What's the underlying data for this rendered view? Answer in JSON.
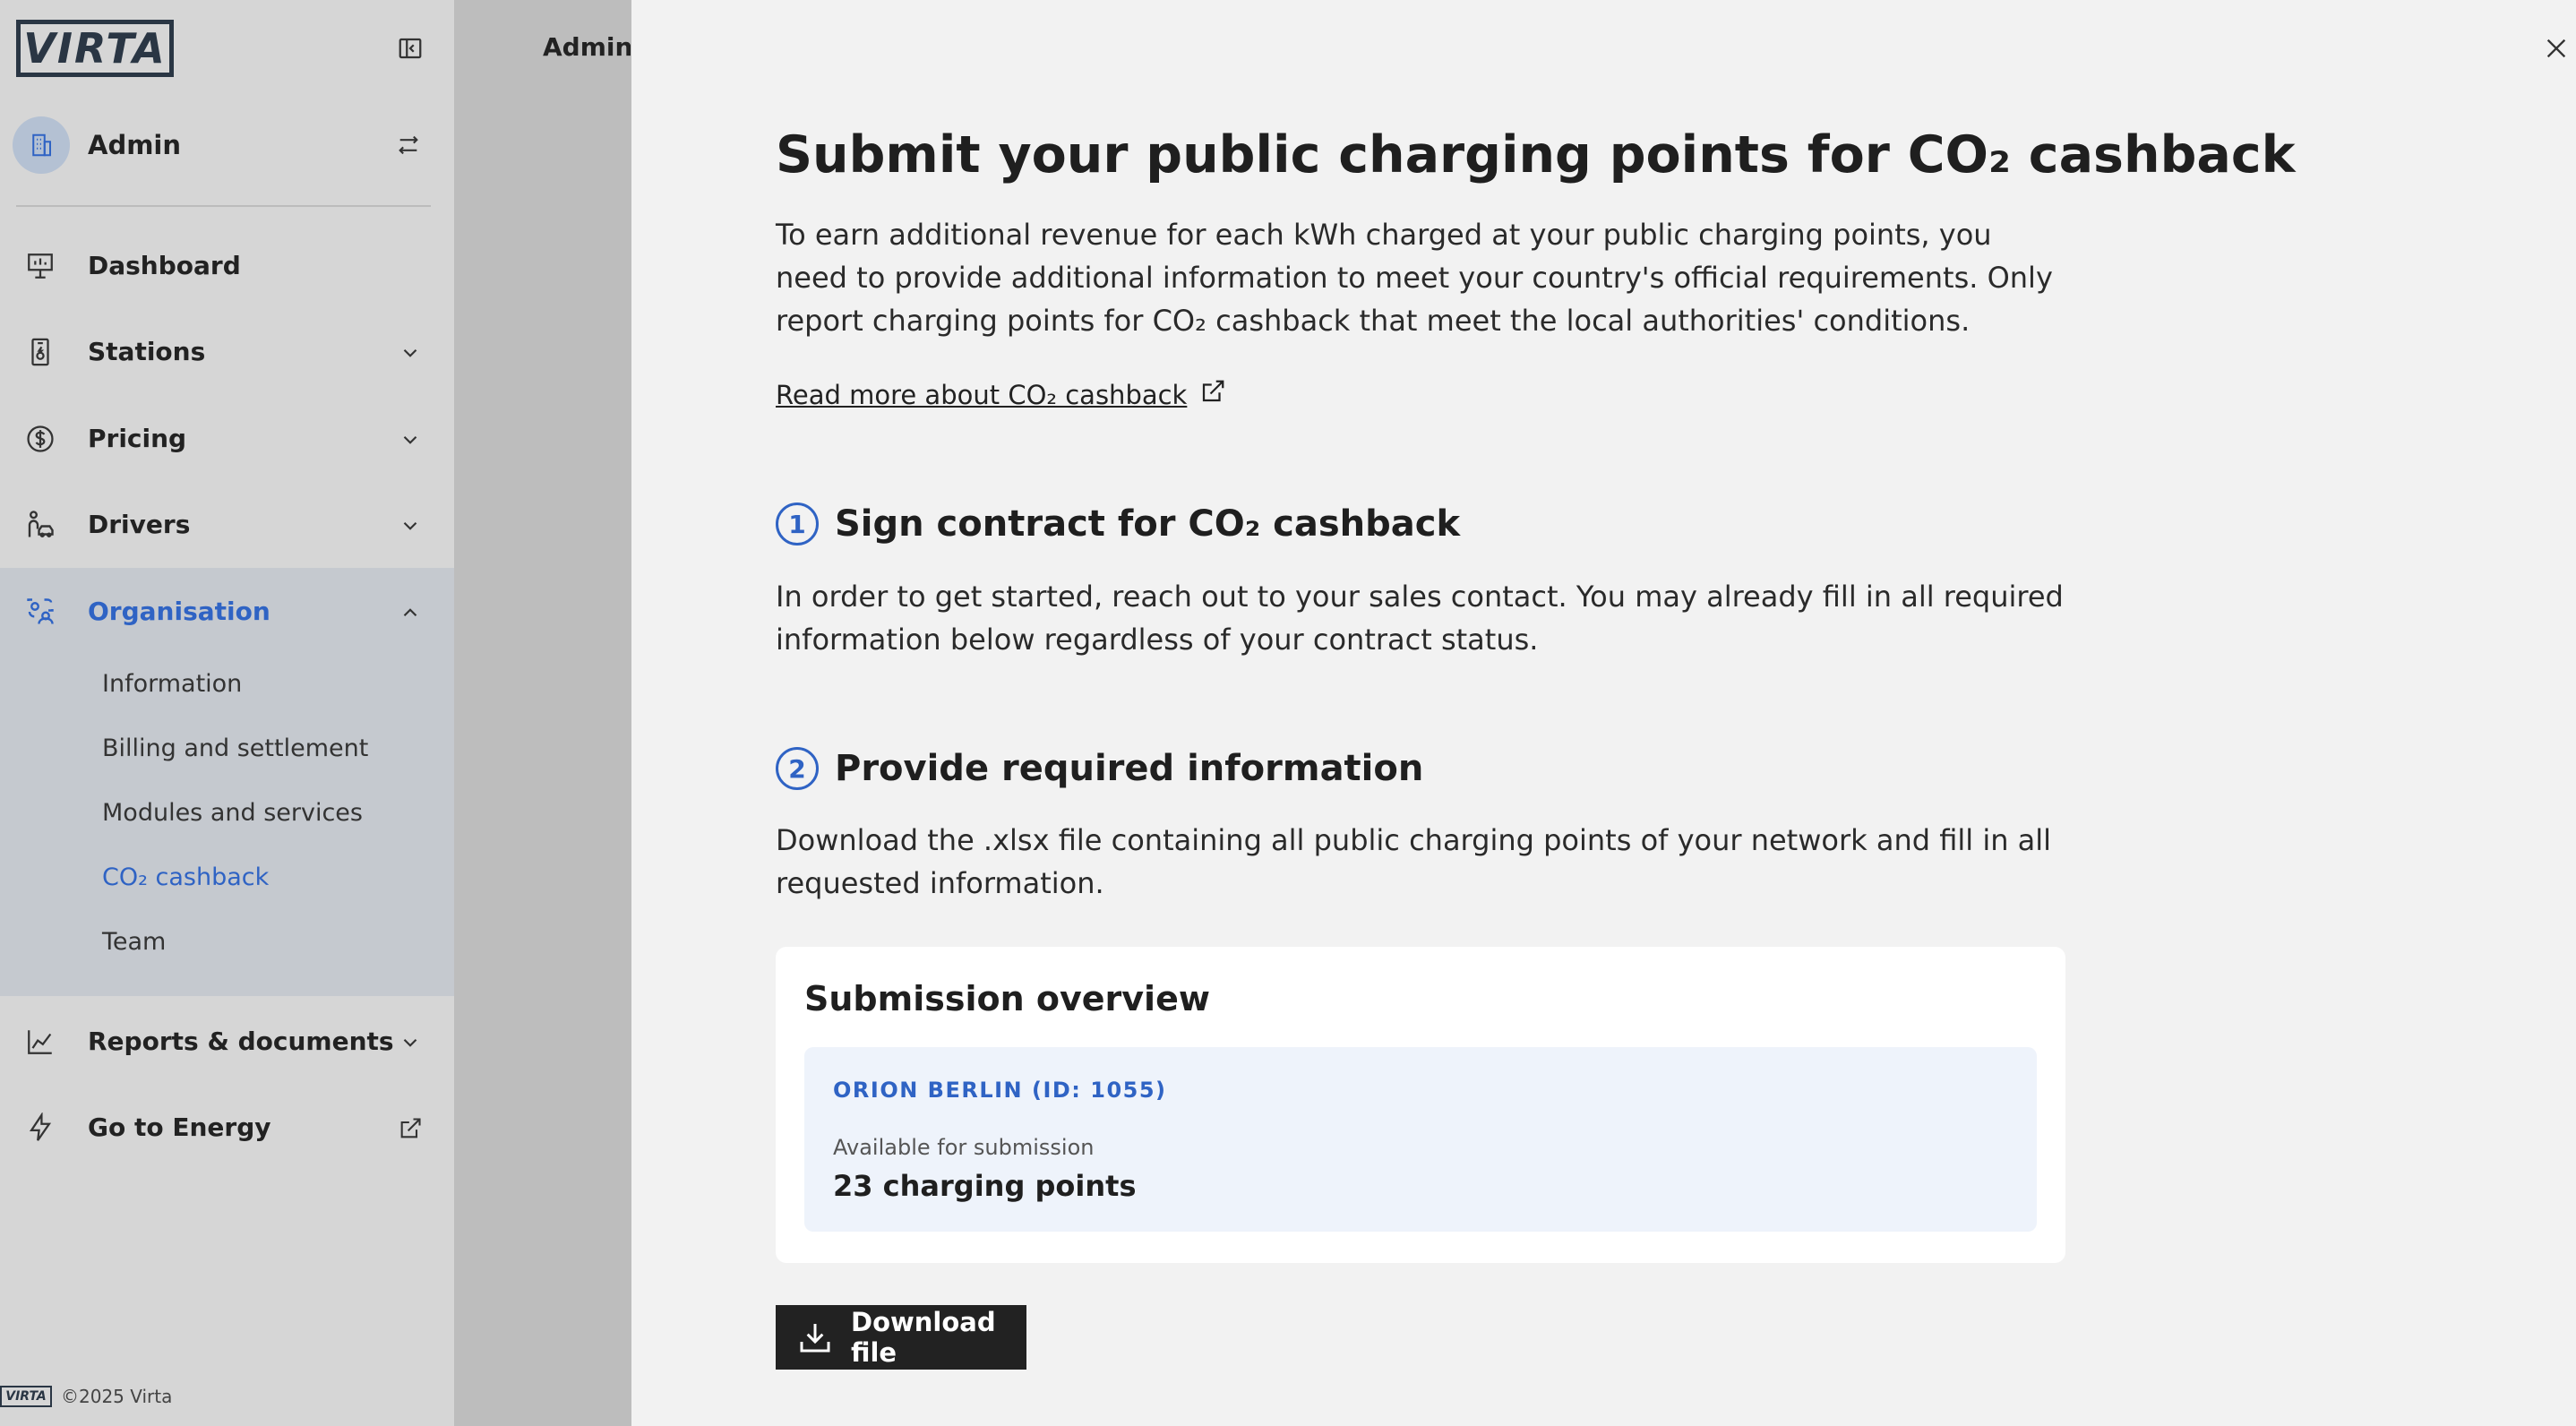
{
  "app": {
    "logo_text": "VIRTA"
  },
  "sidebar": {
    "org_name": "Admin",
    "items": [
      {
        "label": "Dashboard",
        "icon": "dashboard-icon"
      },
      {
        "label": "Stations",
        "icon": "station-icon"
      },
      {
        "label": "Pricing",
        "icon": "dollar-icon"
      },
      {
        "label": "Drivers",
        "icon": "driver-icon"
      },
      {
        "label": "Organisation",
        "icon": "organisation-icon"
      },
      {
        "label": "Reports & documents",
        "icon": "chart-icon"
      },
      {
        "label": "Go to Energy",
        "icon": "lightning-icon"
      }
    ],
    "org_sub_items": [
      {
        "label": "Information"
      },
      {
        "label": "Billing and settlement"
      },
      {
        "label": "Modules and services"
      },
      {
        "label": "CO₂ cashback"
      },
      {
        "label": "Team"
      }
    ],
    "footer": {
      "logo_text": "VIRTA",
      "copyright": "©2025 Virta"
    }
  },
  "background": {
    "page_title": "Admin ("
  },
  "drawer": {
    "title": "Submit your public charging points for CO₂ cashback",
    "intro": "To earn additional revenue for each kWh charged at your public charging points, you need to provide additional information to meet your country's official requirements. Only report charging points for CO₂ cashback that meet the local authorities' conditions.",
    "read_more": "Read more about CO₂ cashback",
    "steps": [
      {
        "number": "1",
        "title": "Sign contract for CO₂ cashback",
        "text": "In order to get started, reach out to your sales contact. You may already fill in all required information below regardless of your contract status."
      },
      {
        "number": "2",
        "title": "Provide required information",
        "text": "Download the .xlsx file containing all public charging points of your network and fill in all requested information."
      }
    ],
    "submission": {
      "title": "Submission overview",
      "site_name": "ORION BERLIN (ID: 1055)",
      "available_label": "Available for submission",
      "available_value": "23 charging points"
    },
    "download_label": "Download file"
  },
  "colors": {
    "accent": "#2f63c4",
    "sidebar_bg": "#d6d6d6",
    "drawer_bg": "#f2f2f2",
    "button_bg": "#222222"
  }
}
